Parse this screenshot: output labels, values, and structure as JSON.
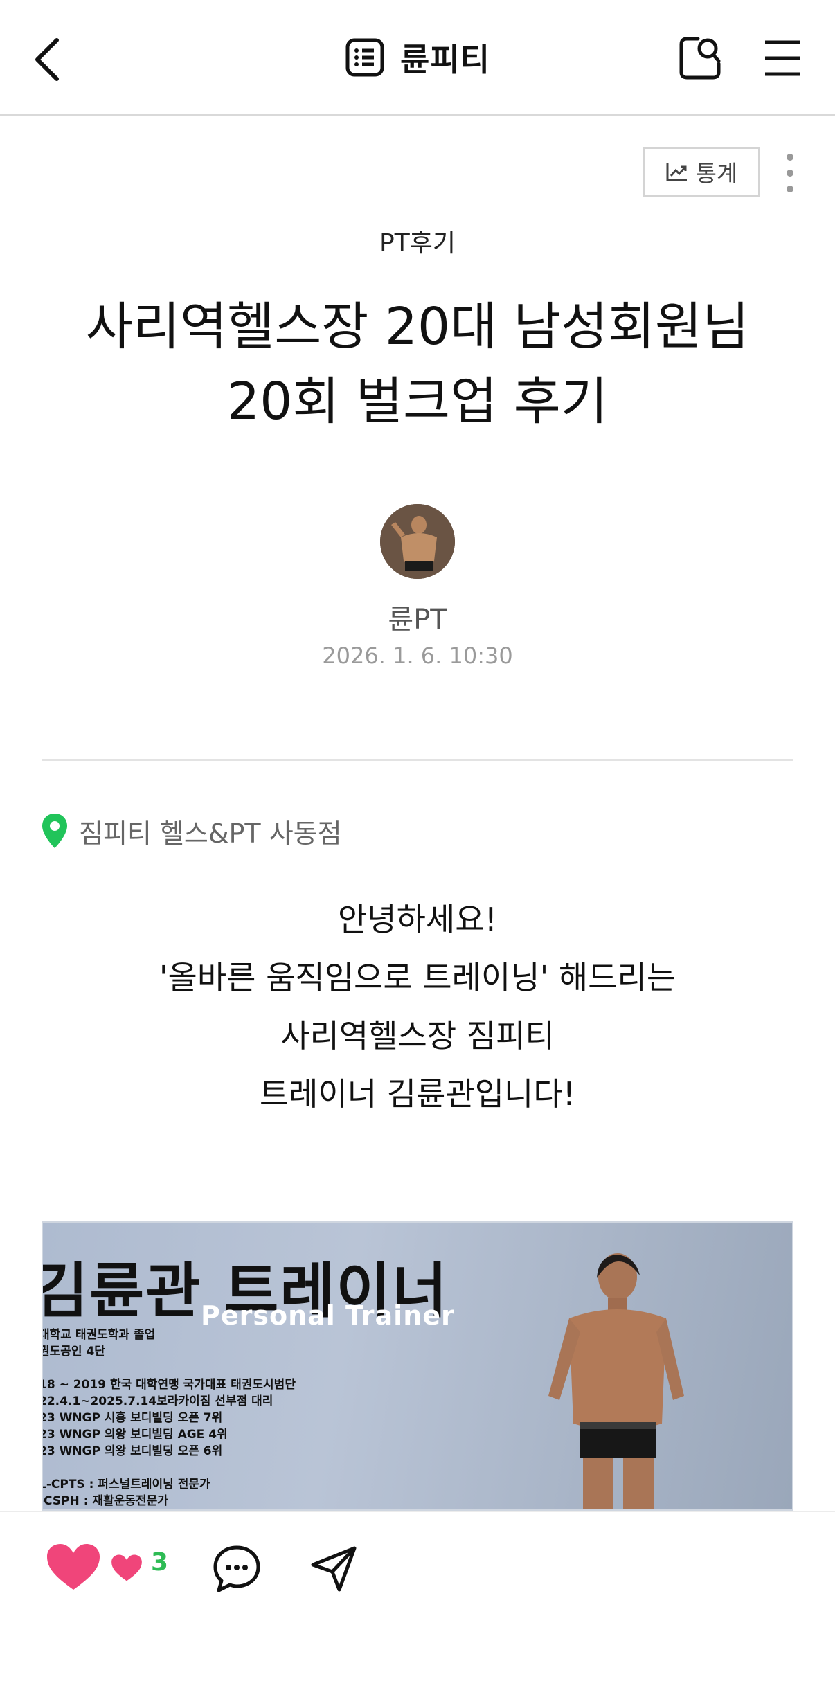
{
  "header": {
    "back_icon": "chevron-left-icon",
    "title_icon": "list-icon",
    "title": "륜피티",
    "search_icon": "search-icon",
    "menu_icon": "hamburger-icon"
  },
  "toolbar": {
    "stats_label": "통계",
    "stats_icon": "trend-chart-icon",
    "more_icon": "more-vertical-icon"
  },
  "post": {
    "category": "PT후기",
    "title_line1": "사리역헬스장 20대 남성회원님",
    "title_line2": "20회 벌크업 후기",
    "author": "륜PT",
    "date": "2026. 1. 6. 10:30",
    "location": "짐피티 헬스&PT 사동점",
    "location_icon": "map-pin-icon",
    "body": [
      "안녕하세요!",
      "'올바른 움직임으로 트레이닝' 해드리는",
      "사리역헬스장 짐피티",
      "트레이너 김륜관입니다!"
    ]
  },
  "image": {
    "heading": "김륜관 트레이너",
    "subheading": "Personal Trainer",
    "lines": [
      "대학교 태권도학과 졸업",
      "권도공인 4단",
      "",
      "18 ~ 2019 한국 대학연맹 국가대표 태권도시범단",
      "22.4.1~2025.7.14보라카이짐 선부점 대리",
      "23 WNGP 시흥 보디빌딩 오픈 7위",
      "23 WNGP 의왕 보디빌딩 AGE 4위",
      "23 WNGP 의왕 보디빌딩 오픈 6위",
      "",
      "L-CPTS : 퍼스널트레이닝 전문가",
      "-CSPH : 재활운동전문가"
    ]
  },
  "actions": {
    "like_count": "3",
    "like_icon": "heart-icon",
    "comment_icon": "comment-icon",
    "share_icon": "send-icon"
  },
  "colors": {
    "accent_green": "#2dbb54",
    "heart_pink": "#f0457a",
    "pin_green": "#21c45a"
  }
}
